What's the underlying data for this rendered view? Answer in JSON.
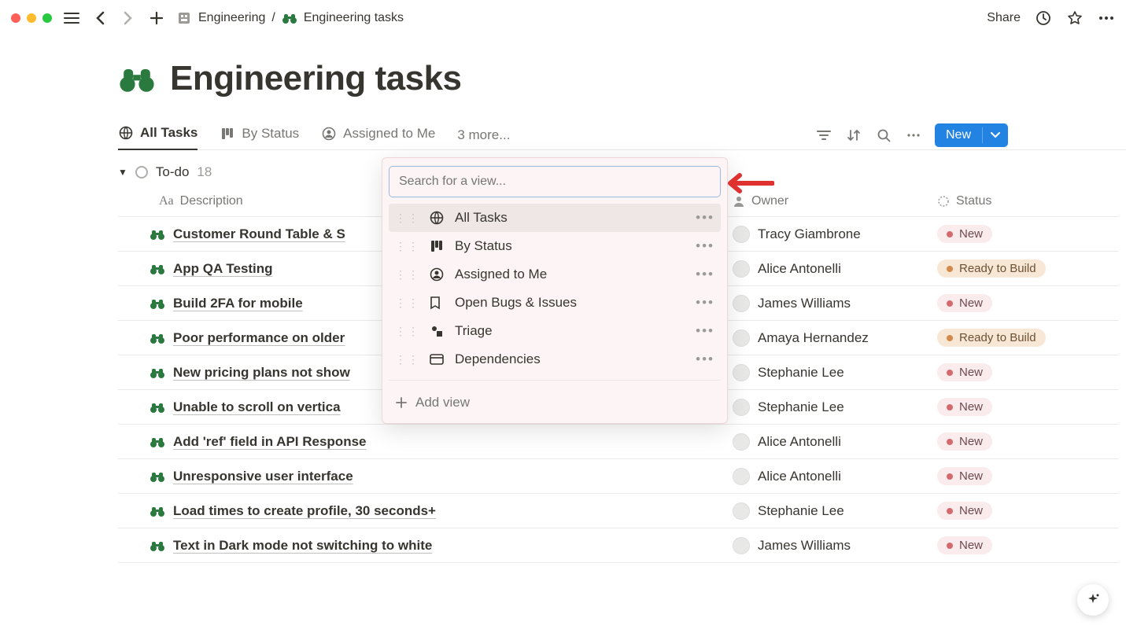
{
  "breadcrumb": {
    "parent": "Engineering",
    "sep": "/",
    "page": "Engineering tasks"
  },
  "header": {
    "share": "Share"
  },
  "page_title": "Engineering tasks",
  "tabs": {
    "all": "All Tasks",
    "status": "By Status",
    "assigned": "Assigned to Me",
    "more": "3 more..."
  },
  "new_button": "New",
  "group": {
    "name": "To-do",
    "count": "18"
  },
  "columns": {
    "desc": "Description",
    "owner": "Owner",
    "status": "Status"
  },
  "rows": [
    {
      "desc": "Customer Round Table & S",
      "owner": "Tracy Giambrone",
      "status": "New"
    },
    {
      "desc": "App QA Testing",
      "owner": "Alice Antonelli",
      "status": "Ready to Build"
    },
    {
      "desc": "Build 2FA for mobile",
      "owner": "James Williams",
      "status": "New"
    },
    {
      "desc": "Poor performance on older",
      "owner": "Amaya Hernandez",
      "status": "Ready to Build"
    },
    {
      "desc": "New pricing plans not show",
      "owner": "Stephanie Lee",
      "status": "New"
    },
    {
      "desc": "Unable to scroll on vertica",
      "owner": "Stephanie Lee",
      "status": "New"
    },
    {
      "desc": "Add 'ref' field in API Response",
      "owner": "Alice Antonelli",
      "status": "New"
    },
    {
      "desc": "Unresponsive user interface",
      "owner": "Alice Antonelli",
      "status": "New"
    },
    {
      "desc": "Load times to create profile, 30 seconds+",
      "owner": "Stephanie Lee",
      "status": "New"
    },
    {
      "desc": "Text in Dark mode not switching to white",
      "owner": "James Williams",
      "status": "New"
    }
  ],
  "popover": {
    "placeholder": "Search for a view...",
    "views": [
      {
        "label": "All Tasks",
        "icon": "globe"
      },
      {
        "label": "By Status",
        "icon": "board"
      },
      {
        "label": "Assigned to Me",
        "icon": "person"
      },
      {
        "label": "Open Bugs & Issues",
        "icon": "bookmark"
      },
      {
        "label": "Triage",
        "icon": "shapes"
      },
      {
        "label": "Dependencies",
        "icon": "card"
      }
    ],
    "add_view": "Add view"
  }
}
